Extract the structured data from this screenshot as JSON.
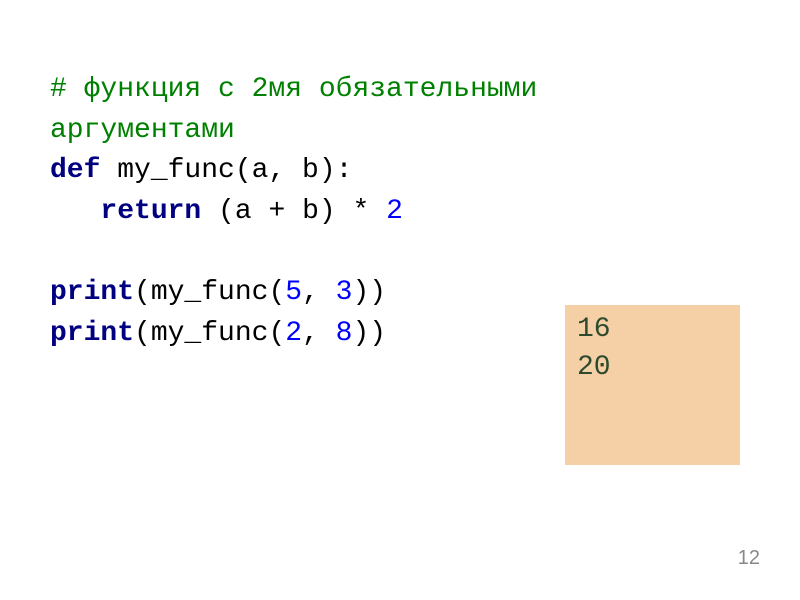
{
  "code": {
    "comment_line1": "# функция с 2мя обязательными",
    "comment_line2": "аргументами",
    "def_kw": "def",
    "func_sig": " my_func(a, b):",
    "indent": "   ",
    "return_kw": "return",
    "return_expr1": " (a + b) * ",
    "return_num": "2",
    "print1_kw": "print",
    "print1_open": "(my_func(",
    "print1_arg1": "5",
    "print1_sep": ", ",
    "print1_arg2": "3",
    "print1_close": "))",
    "print2_kw": "print",
    "print2_open": "(my_func(",
    "print2_arg1": "2",
    "print2_sep": ", ",
    "print2_arg2": "8",
    "print2_close": "))"
  },
  "output": {
    "line1": "16",
    "line2": "20"
  },
  "page_number": "12"
}
